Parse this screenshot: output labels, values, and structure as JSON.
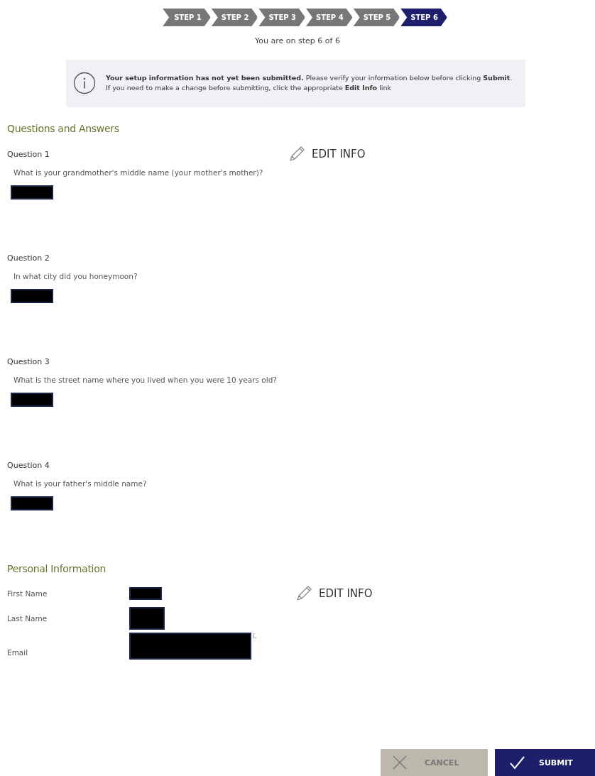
{
  "steps": [
    {
      "label": "STEP 1",
      "selected": false
    },
    {
      "label": "STEP 2",
      "selected": false
    },
    {
      "label": "STEP 3",
      "selected": false
    },
    {
      "label": "STEP 4",
      "selected": false
    },
    {
      "label": "STEP 5",
      "selected": false
    },
    {
      "label": "STEP 6",
      "selected": true
    }
  ],
  "step_status": "You are on step 6 of 6",
  "notice": {
    "text": "**Your setup information has not yet been submitted.** Please verify your information below before clicking **Submit**. If you need to make a change before submitting, click the appropriate **Edit Info** link"
  },
  "questions_section": {
    "title": "Questions and Answers",
    "edit_link": "EDIT INFO",
    "questions": [
      {
        "label": "Question 1",
        "text": "What is your grandmother's middle name (your mother's mother)?",
        "answer_redacted": true
      },
      {
        "label": "Question 2",
        "text": "In what city did you honeymoon?",
        "answer_redacted": true
      },
      {
        "label": "Question 3",
        "text": "What is the street name where you lived when you were 10 years old?",
        "answer_redacted": true
      },
      {
        "label": "Question 4",
        "text": "What is your father's middle name?",
        "answer_redacted": true
      }
    ]
  },
  "personal_section": {
    "title": "Personal Information",
    "edit_link": "EDIT INFO",
    "fields": [
      {
        "label": "First Name",
        "kind": "short",
        "redacted": true
      },
      {
        "label": "Last Name",
        "kind": "tall",
        "redacted": true
      },
      {
        "label": "Email",
        "kind": "wide",
        "redacted": true,
        "tail": "L"
      }
    ]
  },
  "buttons": [
    {
      "label": "CANCEL",
      "kind": "cancel"
    },
    {
      "label": "SUBMIT",
      "kind": "submit"
    }
  ]
}
